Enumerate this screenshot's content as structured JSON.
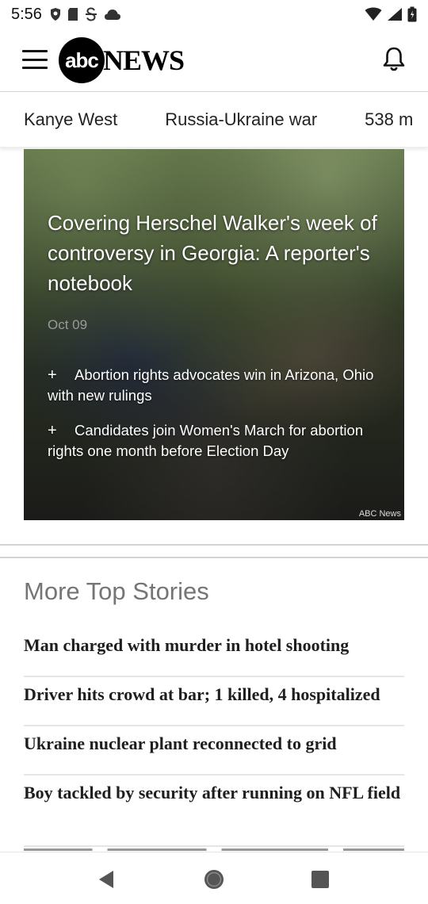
{
  "status_bar": {
    "time": "5:56"
  },
  "header": {
    "logo_mark": "abc",
    "logo_word": "NEWS"
  },
  "topics": [
    {
      "label": "Kanye West"
    },
    {
      "label": "Russia-Ukraine war"
    },
    {
      "label": "538 m"
    }
  ],
  "hero": {
    "title": "Covering Herschel Walker's week of controversy in Georgia: A reporter's notebook",
    "date": "Oct 09",
    "related": [
      {
        "marker": "+",
        "text": "Abortion rights advocates win in Arizona, Ohio with new rulings"
      },
      {
        "marker": "+",
        "text": "Candidates join Women's March for abortion rights one month before Election Day"
      }
    ],
    "credit": "ABC News"
  },
  "more_top_stories": {
    "title": "More Top Stories",
    "items": [
      {
        "headline": "Man charged with murder in hotel shooting"
      },
      {
        "headline": "Driver hits crowd at bar; 1 killed, 4 hospitalized"
      },
      {
        "headline": "Ukraine nuclear plant reconnected to grid"
      },
      {
        "headline": "Boy tackled by security after running on NFL field"
      }
    ]
  },
  "icons": {
    "menu": "hamburger-menu-icon",
    "notifications": "bell-icon",
    "nav_back": "triangle-back-icon",
    "nav_home": "circle-home-icon",
    "nav_recent": "square-recents-icon"
  },
  "colors": {
    "section_title": "#757575",
    "divider": "#d2d2d2",
    "text": "#1e1e1e"
  }
}
